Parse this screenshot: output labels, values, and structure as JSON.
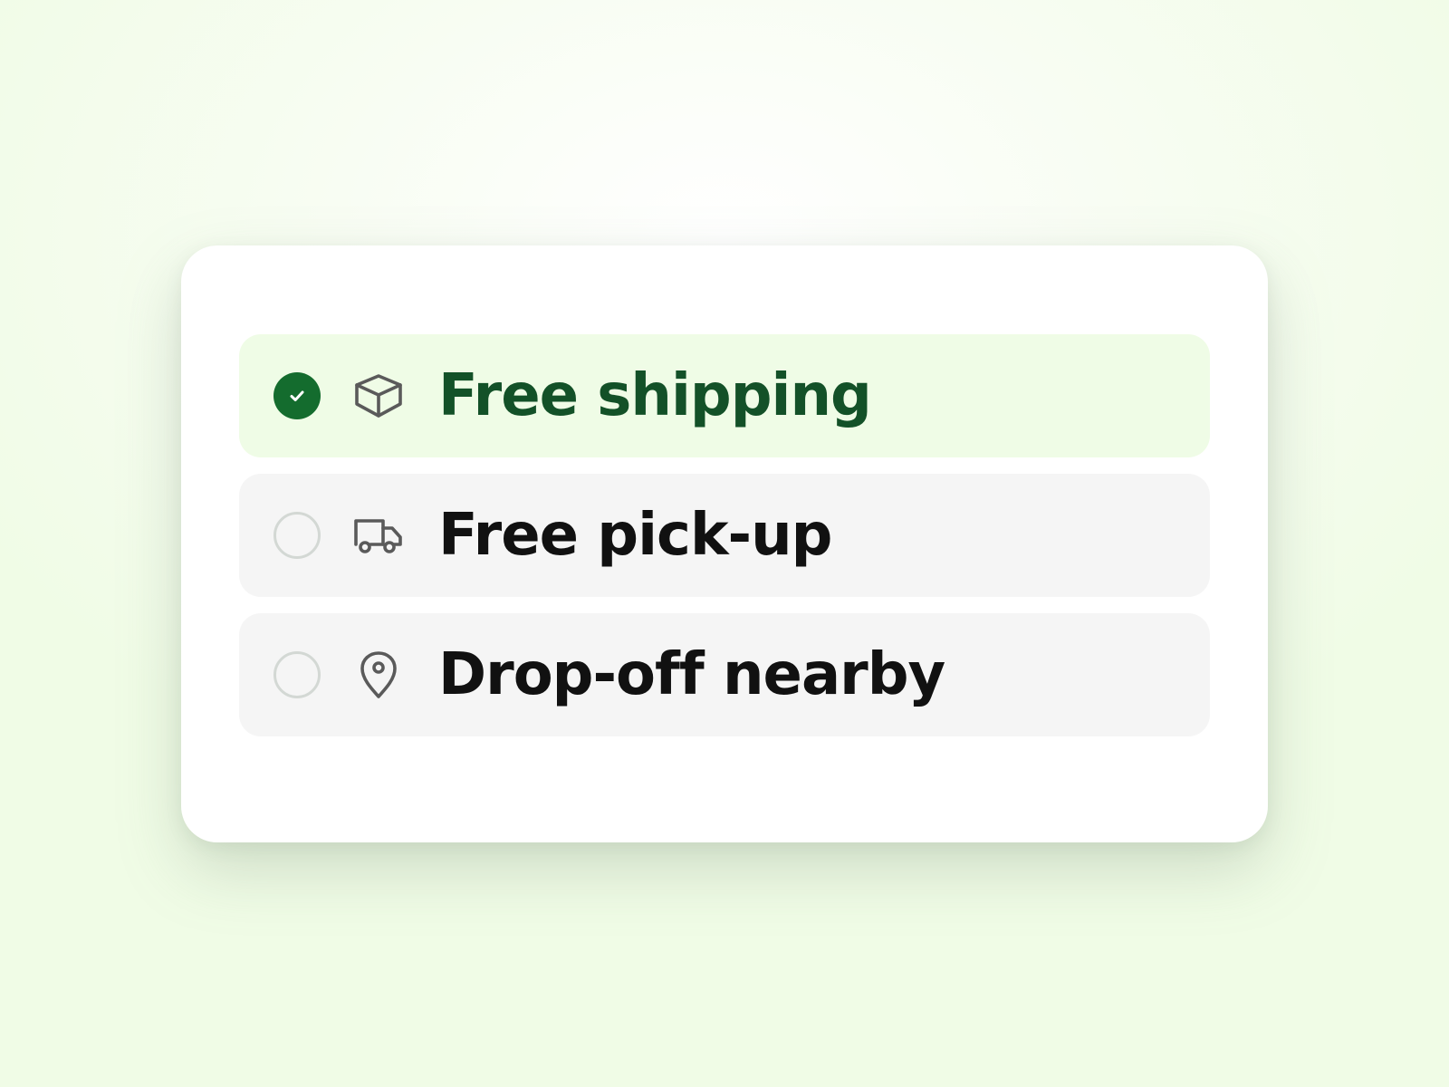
{
  "colors": {
    "accent": "#146c2e",
    "selected_text": "#135128",
    "selected_bg": "#effce6",
    "option_bg": "#f5f5f5",
    "radio_border": "#d3d8d4",
    "icon_stroke": "#5a5a5a"
  },
  "shipping_options": [
    {
      "label": "Free shipping",
      "icon": "box-icon",
      "selected": true
    },
    {
      "label": "Free pick-up",
      "icon": "truck-icon",
      "selected": false
    },
    {
      "label": "Drop-off nearby",
      "icon": "map-pin-icon",
      "selected": false
    }
  ]
}
